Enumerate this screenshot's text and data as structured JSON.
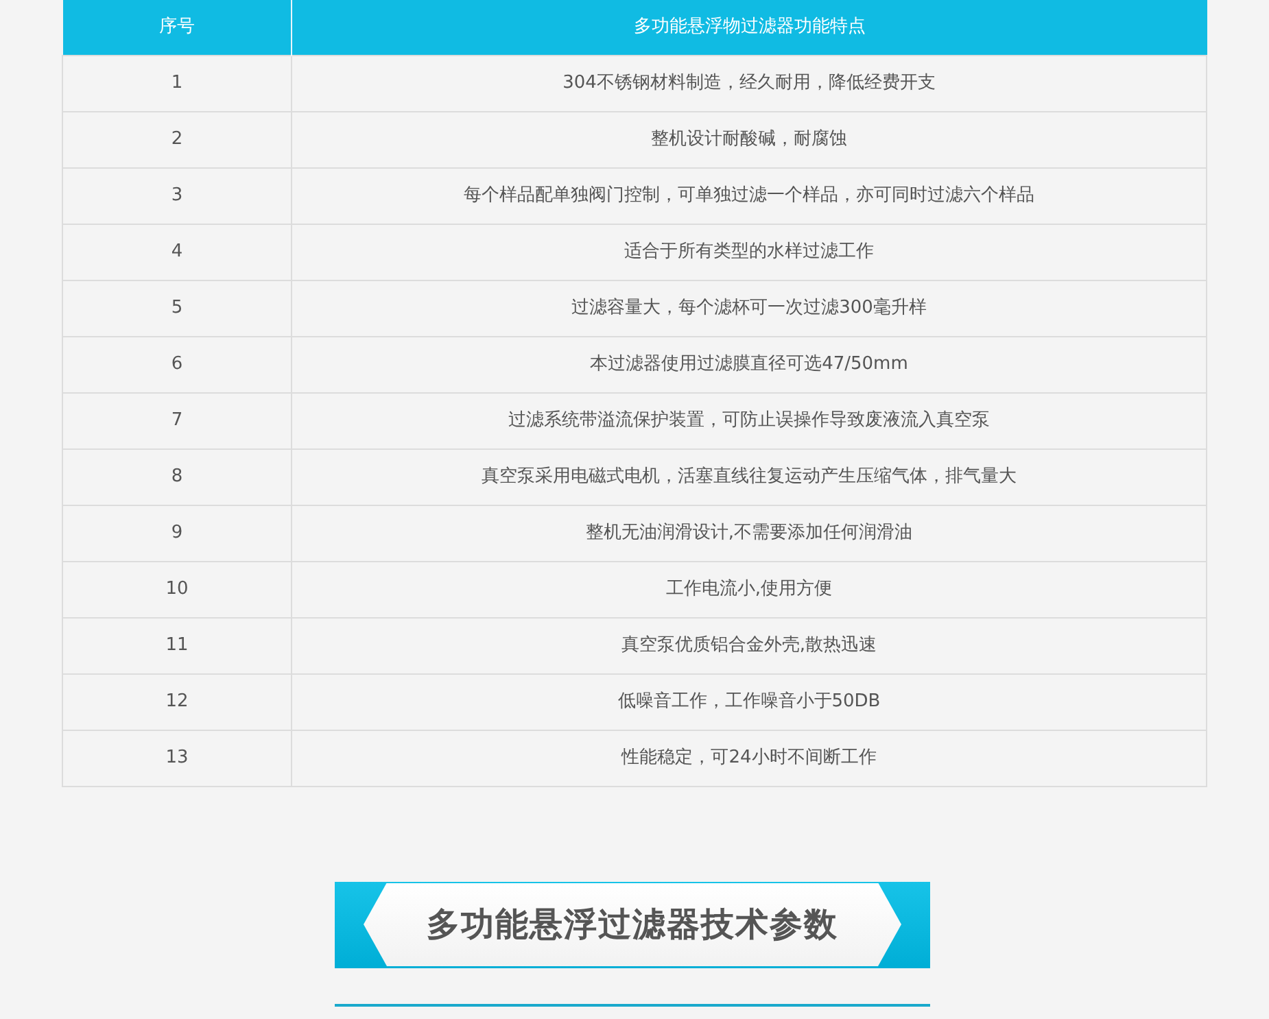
{
  "table": {
    "columns": [
      "序号",
      "多功能悬浮物过滤器功能特点"
    ],
    "rows": [
      [
        "1",
        "304不锈钢材料制造，经久耐用，降低经费开支"
      ],
      [
        "2",
        "整机设计耐酸碱，耐腐蚀"
      ],
      [
        "3",
        "每个样品配单独阀门控制，可单独过滤一个样品，亦可同时过滤六个样品"
      ],
      [
        "4",
        "适合于所有类型的水样过滤工作"
      ],
      [
        "5",
        "过滤容量大，每个滤杯可一次过滤300毫升样"
      ],
      [
        "6",
        "本过滤器使用过滤膜直径可选47/50mm"
      ],
      [
        "7",
        "过滤系统带溢流保护装置，可防止误操作导致废液流入真空泵"
      ],
      [
        "8",
        "真空泵采用电磁式电机，活塞直线往复运动产生压缩气体，排气量大"
      ],
      [
        "9",
        "整机无油润滑设计,不需要添加任何润滑油"
      ],
      [
        "10",
        "工作电流小,使用方便"
      ],
      [
        "11",
        "真空泵优质铝合金外壳,散热迅速"
      ],
      [
        "12",
        "低噪音工作，工作噪音小于50DB"
      ],
      [
        "13",
        "性能稳定，可24小时不间断工作"
      ]
    ]
  },
  "section_banner": {
    "title": "多功能悬浮过滤器技术参数"
  }
}
